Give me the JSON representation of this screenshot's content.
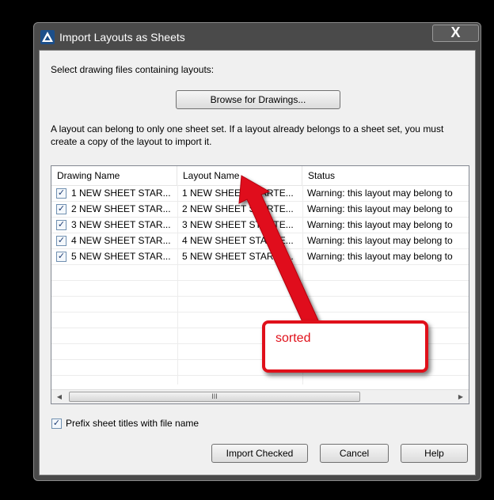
{
  "window": {
    "title": "Import Layouts as Sheets",
    "close_glyph": "X"
  },
  "select_label": "Select drawing files containing layouts:",
  "browse_button": "Browse for Drawings...",
  "description": "A layout can belong to only one sheet set. If a layout already belongs to a sheet set, you must create a copy of the layout to import it.",
  "table": {
    "columns": [
      "Drawing Name",
      "Layout Name",
      "Status"
    ],
    "rows": [
      {
        "checked": true,
        "drawing": "1 NEW SHEET STAR...",
        "layout": "1 NEW SHEET STARTE...",
        "status": "Warning: this layout may belong to"
      },
      {
        "checked": true,
        "drawing": "2 NEW SHEET STAR...",
        "layout": "2 NEW SHEET STARTE...",
        "status": "Warning: this layout may belong to"
      },
      {
        "checked": true,
        "drawing": "3 NEW SHEET STAR...",
        "layout": "3 NEW SHEET STARTE...",
        "status": "Warning: this layout may belong to"
      },
      {
        "checked": true,
        "drawing": "4 NEW SHEET STAR...",
        "layout": "4 NEW SHEET STARTE...",
        "status": "Warning: this layout may belong to"
      },
      {
        "checked": true,
        "drawing": "5 NEW SHEET STAR...",
        "layout": "5 NEW SHEET STARTE...",
        "status": "Warning: this layout may belong to"
      }
    ],
    "scroll_thumb_grip": "III"
  },
  "prefix_checkbox": {
    "checked": true,
    "label": "Prefix sheet titles with file name"
  },
  "buttons": {
    "import": "Import Checked",
    "cancel": "Cancel",
    "help": "Help"
  },
  "annotation": {
    "text": "sorted",
    "color": "#e0101a"
  },
  "colors": {
    "accent": "#e0101a",
    "titlebar": "#4a4a4a",
    "dialog_bg": "#f0f0f0"
  }
}
